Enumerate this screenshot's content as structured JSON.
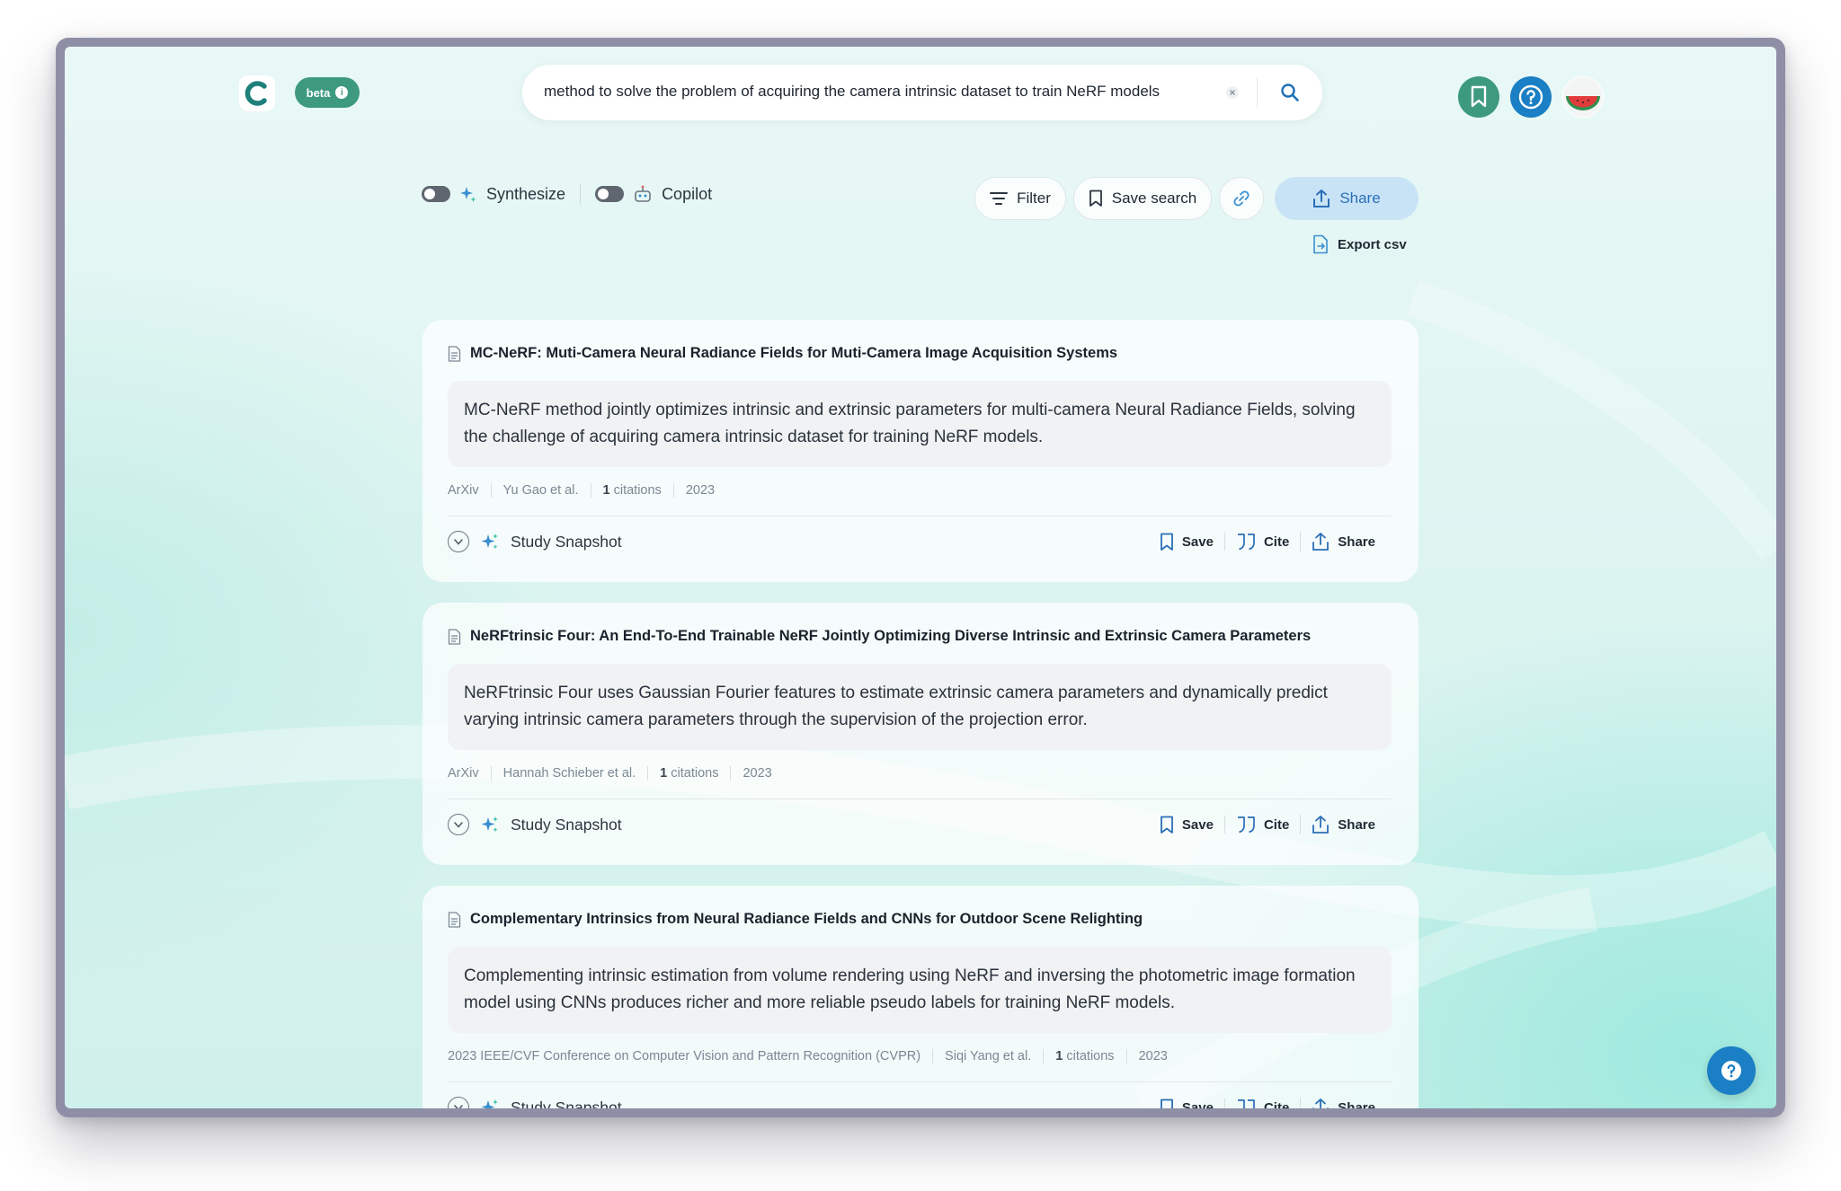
{
  "header": {
    "logo_letter": "C",
    "beta_label": "beta",
    "search": {
      "query": "method to solve the problem of acquiring the camera intrinsic dataset to train NeRF models"
    }
  },
  "toolbar": {
    "synthesize_label": "Synthesize",
    "copilot_label": "Copilot",
    "filter_label": "Filter",
    "save_search_label": "Save search",
    "share_label": "Share",
    "export_label": "Export csv"
  },
  "results": [
    {
      "title": "MC-NeRF: Muti-Camera Neural Radiance Fields for Muti-Camera Image Acquisition Systems",
      "summary": "MC-NeRF method jointly optimizes intrinsic and extrinsic parameters for multi-camera Neural Radiance Fields, solving the challenge of acquiring camera intrinsic dataset for training NeRF models.",
      "venue": "ArXiv",
      "authors": "Yu Gao et al.",
      "citations_count": "1",
      "citations_word": "citations",
      "year": "2023"
    },
    {
      "title": "NeRFtrinsic Four: An End-To-End Trainable NeRF Jointly Optimizing Diverse Intrinsic and Extrinsic Camera Parameters",
      "summary": "NeRFtrinsic Four uses Gaussian Fourier features to estimate extrinsic camera parameters and dynamically predict varying intrinsic camera parameters through the supervision of the projection error.",
      "venue": "ArXiv",
      "authors": "Hannah Schieber et al.",
      "citations_count": "1",
      "citations_word": "citations",
      "year": "2023"
    },
    {
      "title": "Complementary Intrinsics from Neural Radiance Fields and CNNs for Outdoor Scene Relighting",
      "summary": "Complementing intrinsic estimation from volume rendering using NeRF and inversing the photometric image formation model using CNNs produces richer and more reliable pseudo labels for training NeRF models.",
      "venue": "2023 IEEE/CVF Conference on Computer Vision and Pattern Recognition (CVPR)",
      "authors": "Siqi Yang et al.",
      "citations_count": "1",
      "citations_word": "citations",
      "year": "2023"
    }
  ],
  "result_actions": {
    "study_snapshot_label": "Study Snapshot",
    "save_label": "Save",
    "cite_label": "Cite",
    "share_label": "Share"
  },
  "colors": {
    "brand_green": "#3e9a7f",
    "accent_blue": "#1a7fc4",
    "share_bg": "#c9e3f6"
  },
  "icons": {
    "logo": "consensus-logo",
    "bookmarks": "bookmark-icon",
    "help": "question-icon",
    "avatar": "watermelon-avatar"
  }
}
